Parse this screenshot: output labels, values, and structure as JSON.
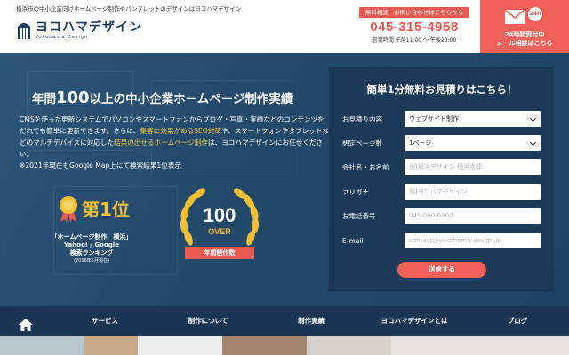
{
  "header": {
    "tagline": "横浜市の中小企業向けホームページ制作やパンフレットのデザインはヨコハマデザイン",
    "logo_name": "ヨコハマデザイン",
    "logo_sub": "Yokohama Design",
    "contact_label": "無料相談・お問い合わせはこちらから",
    "phone": "045-315-4958",
    "hours": "営業時間 午前11:00 〜 午後20:00",
    "mail_badge": "24h",
    "mail_line1": "24時間受付中",
    "mail_line2": "メール相談はこちら",
    "icons": [
      "mail-icon",
      "logo-mark"
    ]
  },
  "hero": {
    "title_pre": "年間",
    "title_num": "100",
    "title_post": "以上の中小企業ホームページ制作実績",
    "desc_1": "CMSを使った更新システムでパソコンやスマートフォンからブログ・写真・実績などのコンテンツをだれでも簡単に更新できます。さらに、",
    "desc_hl1": "集客に効果があるSEO対策",
    "desc_2": "や、スマートフォンやタブレットなどのマルチデバイスに対応した",
    "desc_hl2": "結果の出せるホームページ制作",
    "desc_3": "は、ヨコハマデザインにお任せください。",
    "desc_note": "※2021年現在もGoogle Map上にて検索結果1位表示",
    "award1": {
      "rank": "第1位",
      "line1": "「ホームページ制作　横浜」",
      "line2": "Yahoo! / Google",
      "line3": "検索ランキング",
      "line4": "(2016年5月現在)"
    },
    "award2": {
      "number": "100",
      "over": "OVER",
      "ribbon": "年間制作数"
    }
  },
  "form": {
    "title": "簡単1分無料お見積りはこちら！",
    "fields": [
      {
        "label": "お見積り内容",
        "value": "ウェブサイト制作",
        "placeholder": ""
      },
      {
        "label": "想定ページ数",
        "value": "1ページ",
        "placeholder": ""
      },
      {
        "label": "会社名・お名前",
        "value": "",
        "placeholder": "例)横浜デザイン 横浜太郎"
      },
      {
        "label": "フリガナ",
        "value": "",
        "placeholder": "例)ヨコハマデザイン"
      },
      {
        "label": "お電話番号",
        "value": "",
        "placeholder": "045-000-0000"
      },
      {
        "label": "E-mail",
        "value": "",
        "placeholder": "contact@yokohama-design.jp"
      }
    ],
    "submit": "送信する"
  },
  "nav": {
    "items": [
      "サービス",
      "制作について",
      "制作実績",
      "ヨコハマデザインとは",
      "ブログ"
    ]
  },
  "colors": {
    "accent": "#f06259",
    "navy": "#1b3a58",
    "gold": "#f3c035"
  }
}
